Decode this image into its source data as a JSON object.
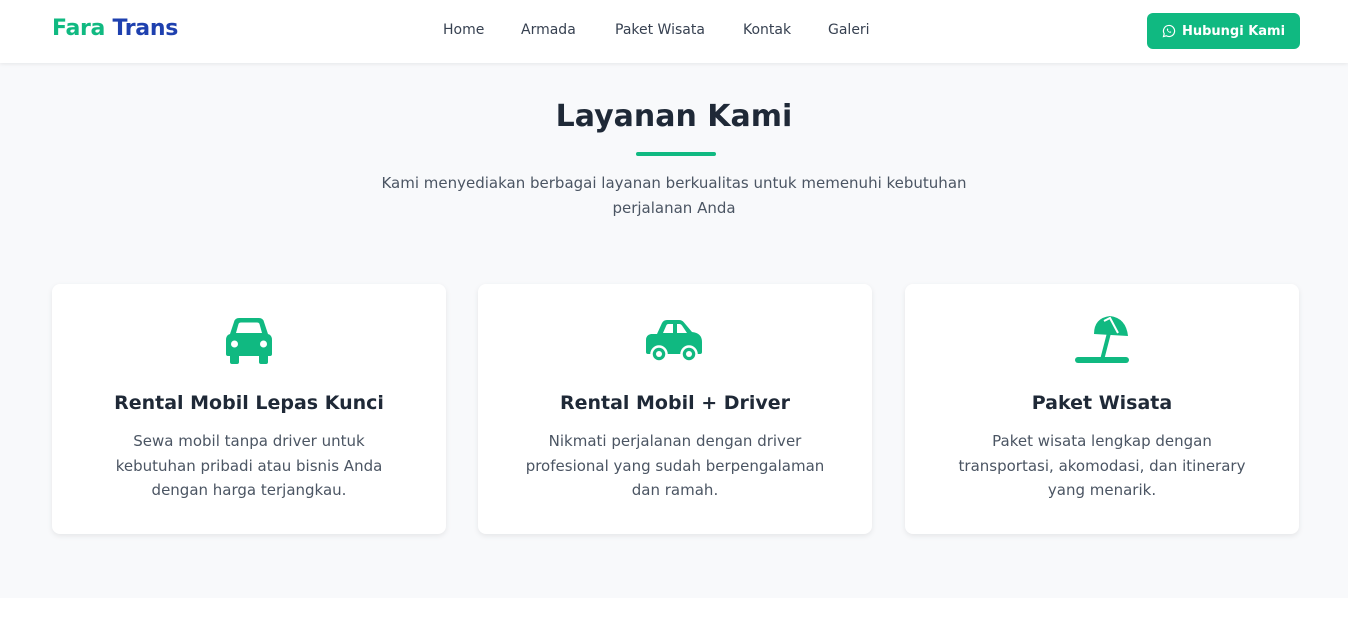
{
  "brand": {
    "part1": "Fara",
    "part2": "Trans"
  },
  "nav": [
    "Home",
    "Armada",
    "Paket Wisata",
    "Kontak",
    "Galeri"
  ],
  "cta": {
    "label": "Hubungi Kami",
    "icon": "whatsapp-icon"
  },
  "services": {
    "title": "Layanan Kami",
    "subtitle": "Kami menyediakan berbagai layanan berkualitas untuk memenuhi kebutuhan perjalanan Anda",
    "cards": [
      {
        "icon": "car-front-icon",
        "title": "Rental Mobil Lepas Kunci",
        "desc": "Sewa mobil tanpa driver untuk kebutuhan pribadi atau bisnis Anda dengan harga terjangkau."
      },
      {
        "icon": "car-side-icon",
        "title": "Rental Mobil + Driver",
        "desc": "Nikmati perjalanan dengan driver profesional yang sudah berpengalaman dan ramah."
      },
      {
        "icon": "umbrella-beach-icon",
        "title": "Paket Wisata",
        "desc": "Paket wisata lengkap dengan transportasi, akomodasi, dan itinerary yang menarik."
      }
    ]
  },
  "colors": {
    "accent": "#10b981",
    "brand_blue": "#1e40af",
    "heading": "#1f2937",
    "body_text": "#4b5563",
    "section_bg": "#f8f9fb"
  }
}
